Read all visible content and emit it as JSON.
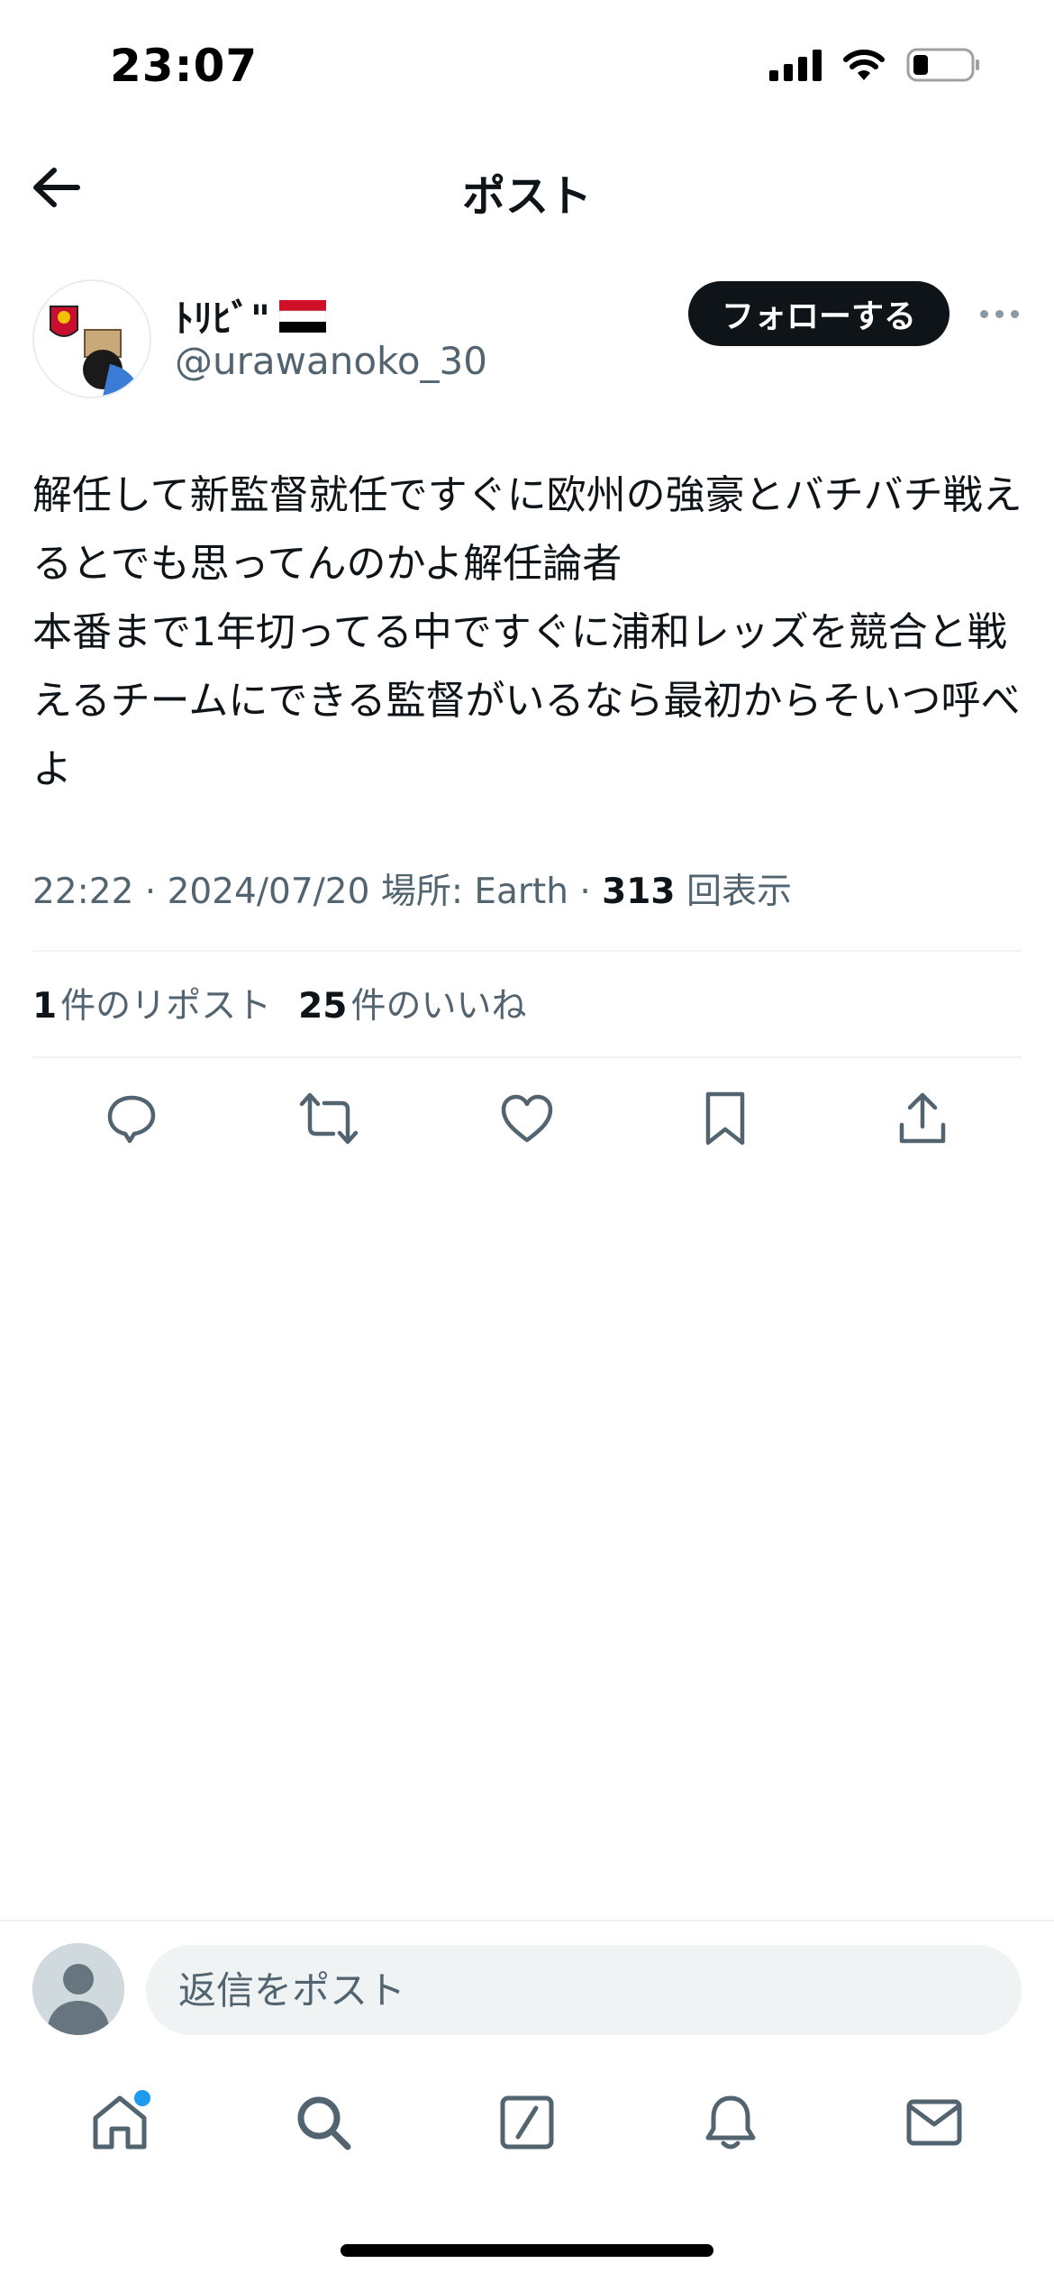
{
  "status_bar": {
    "time": "23:07"
  },
  "header": {
    "title": "ポスト"
  },
  "author": {
    "display_name": "ﾄﾘﾋﾞ\"",
    "handle": "@urawanoko_30",
    "follow_label": "フォローする"
  },
  "post": {
    "text": "解任して新監督就任ですぐに欧州の強豪とバチバチ戦えるとでも思ってんのかよ解任論者\n本番まで1年切ってる中ですぐに浦和レッズを競合と戦えるチームにできる監督がいるなら最初からそいつ呼べよ",
    "time": "22:22",
    "date": "2024/07/20",
    "location": "場所: Earth",
    "views": "313",
    "views_label": "回表示"
  },
  "stats": {
    "reposts": "1",
    "reposts_label": "件のリポスト",
    "likes": "25",
    "likes_label": "件のいいね"
  },
  "reply": {
    "placeholder": "返信をポスト"
  },
  "icons": {
    "back": "arrow-left-icon",
    "more": "more-horizontal-icon",
    "reply": "comment-icon",
    "repost": "repost-icon",
    "like": "heart-icon",
    "bookmark": "bookmark-icon",
    "share": "share-icon",
    "home": "home-icon",
    "search": "search-icon",
    "grok": "slash-square-icon",
    "notifications": "bell-icon",
    "messages": "mail-icon"
  },
  "colors": {
    "text_primary": "#0f1419",
    "text_secondary": "#536471",
    "accent": "#1d9bf0",
    "divider": "#eff3f4"
  }
}
